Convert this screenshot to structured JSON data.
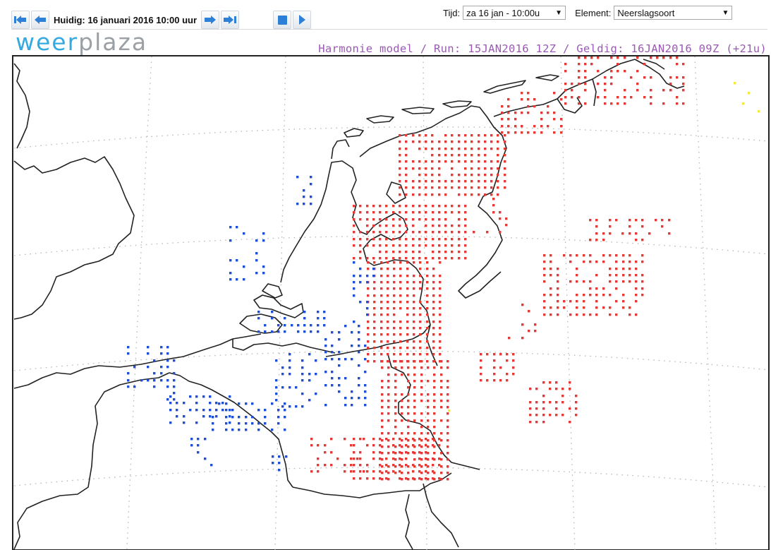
{
  "toolbar": {
    "current_time_label": "Huidig: 16 januari 2016 10:00 uur",
    "buttons": [
      "first-icon",
      "prev-icon",
      "next-icon",
      "last-icon",
      "stop-icon",
      "play-icon"
    ]
  },
  "controls": {
    "tijd_label": "Tijd:",
    "tijd_value": "za 16 jan - 10:00u",
    "element_label": "Element:",
    "element_value": "Neerslagsoort"
  },
  "logo": {
    "part1": "weer",
    "part2": "plaza"
  },
  "model_title": "Harmonie model / Run: 15JAN2016 12Z / Geldig: 16JAN2016 09Z (+21u)",
  "legend_colors": {
    "rain": "#e53935",
    "snow": "#1e4fd8",
    "mixed": "#f5e93a"
  }
}
